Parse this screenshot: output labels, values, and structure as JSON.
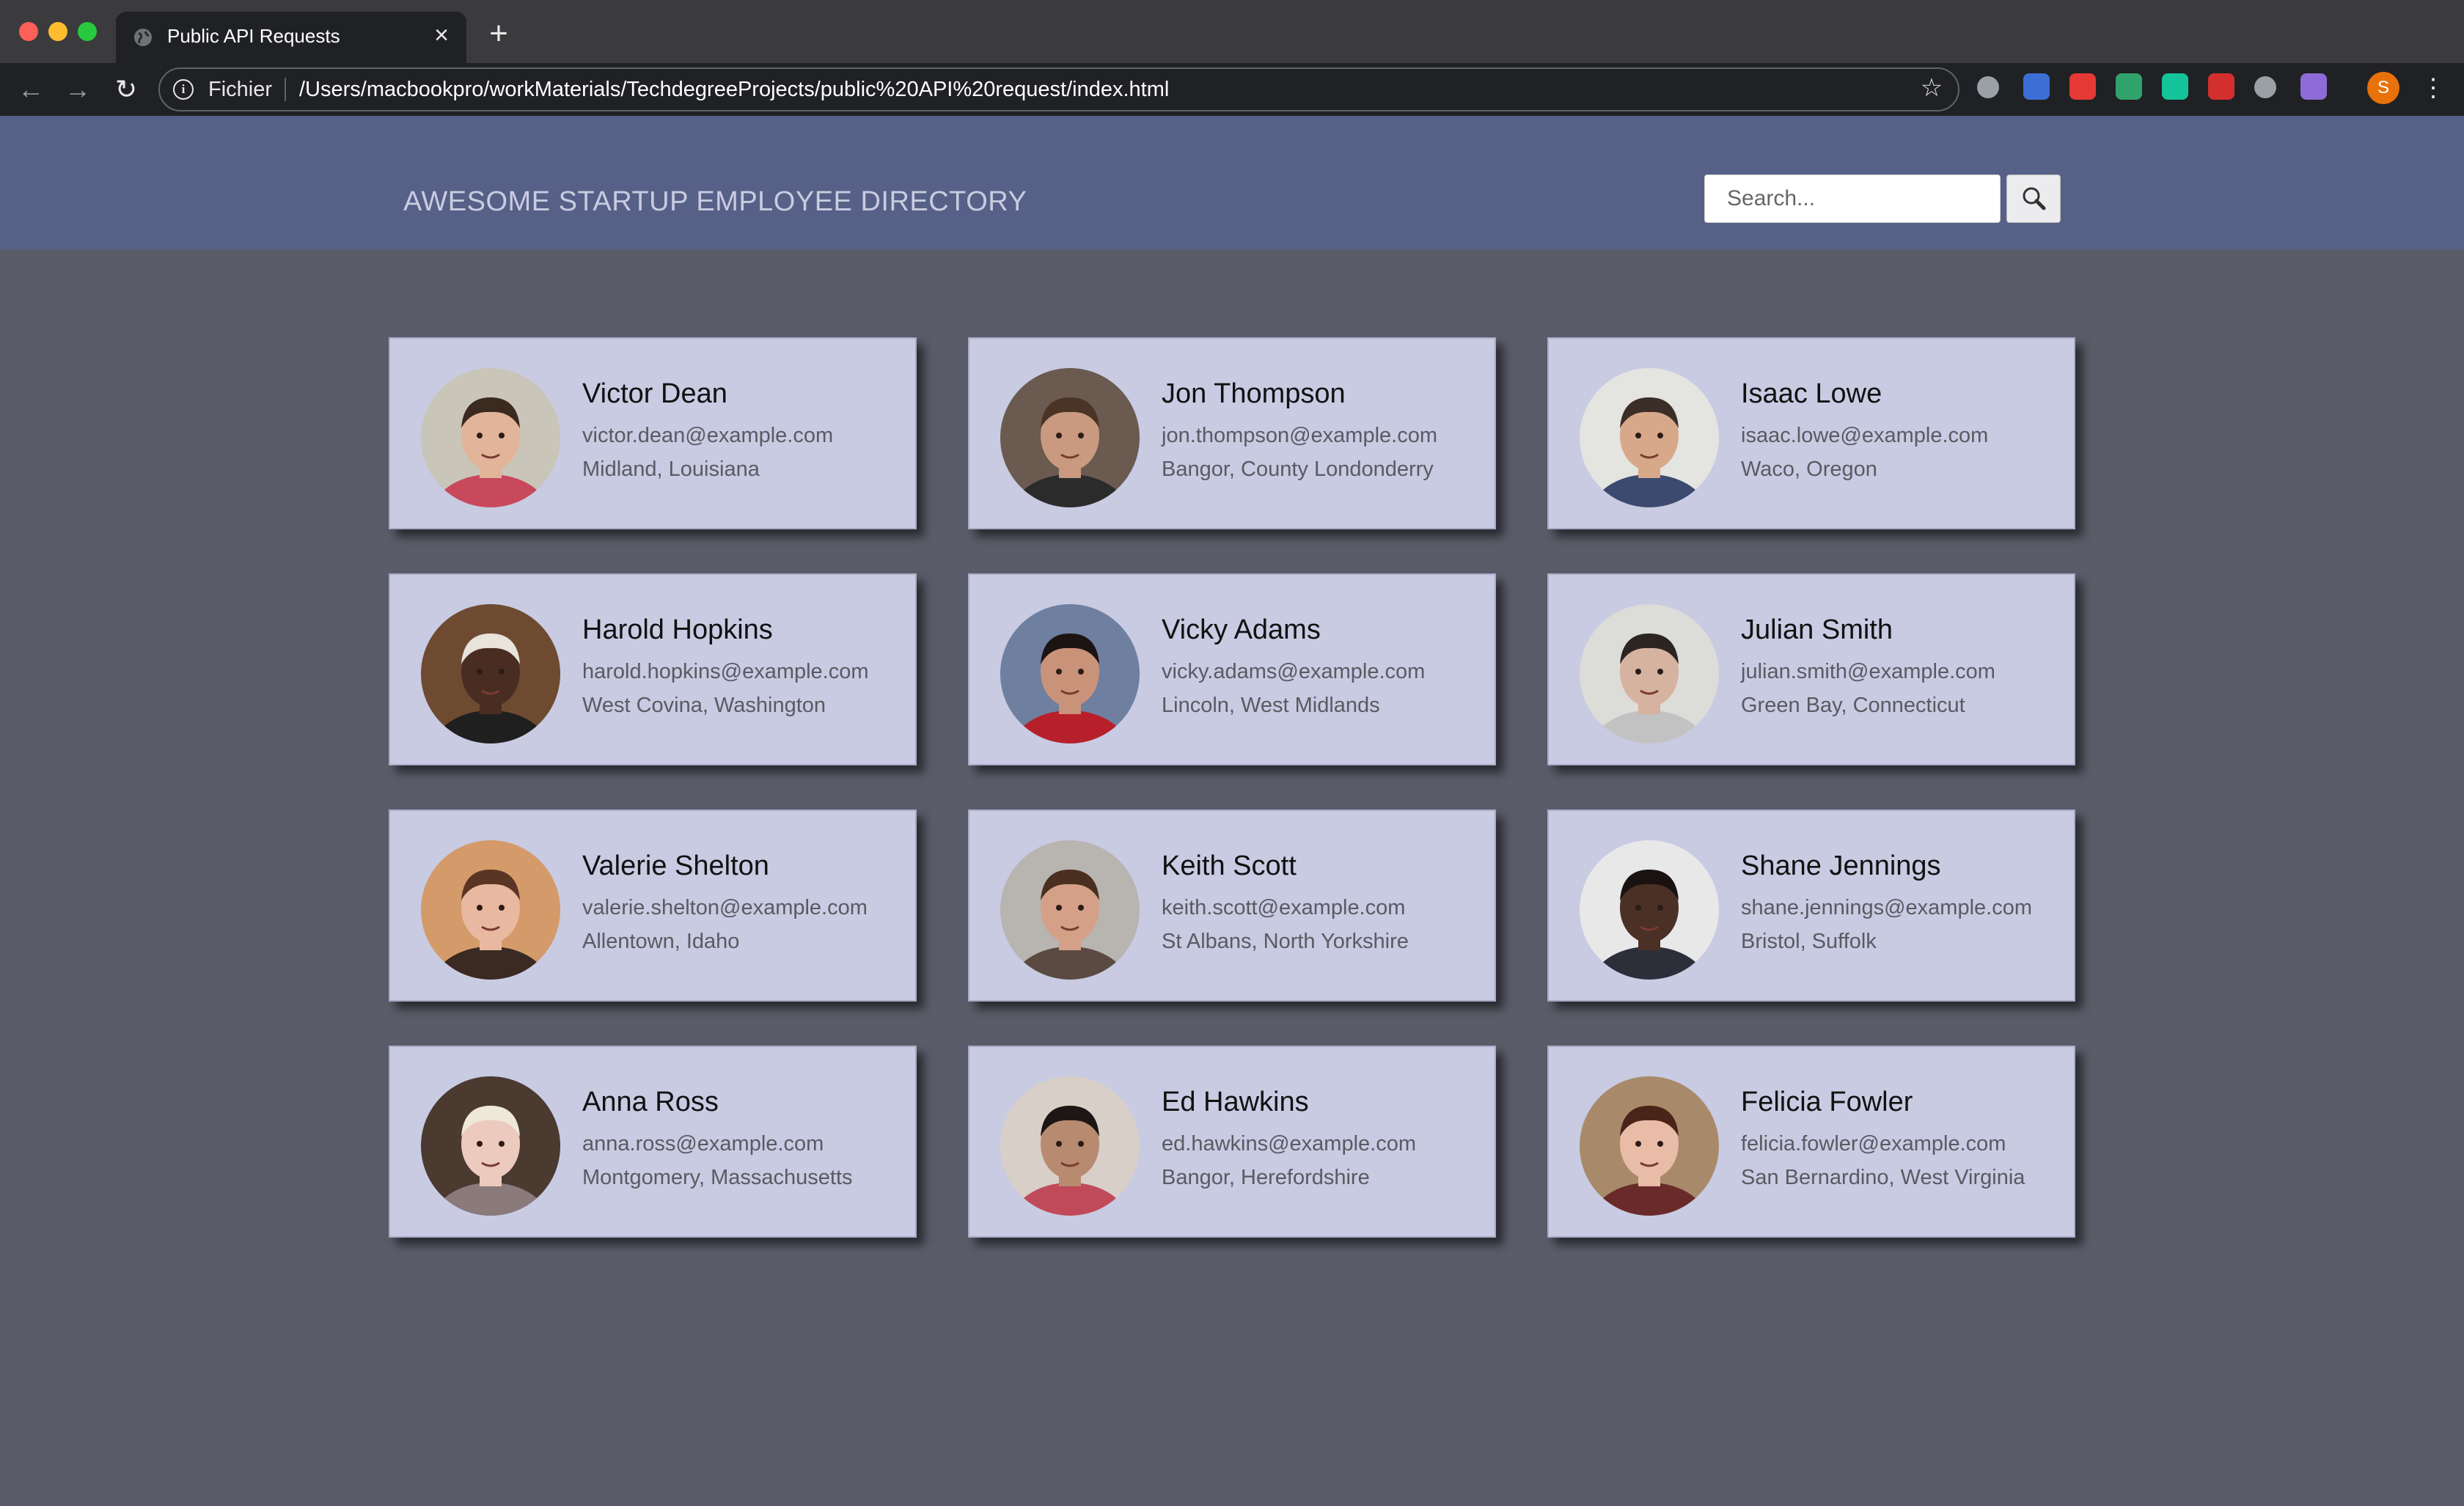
{
  "browser": {
    "tab_title": "Public API Requests",
    "scheme_label": "Fichier",
    "url": "/Users/macbookpro/workMaterials/TechdegreeProjects/public%20API%20request/index.html",
    "profile_initial": "S"
  },
  "header": {
    "title": "AWESOME STARTUP EMPLOYEE DIRECTORY",
    "search_placeholder": "Search...",
    "search_value": ""
  },
  "colors": {
    "header_bg": "#576087",
    "page_bg": "#5b5c69",
    "card_bg": "#c8cbe2"
  },
  "employees": [
    {
      "name": "Victor Dean",
      "email": "victor.dean@example.com",
      "location": "Midland, Louisiana",
      "skin": "#e2b59a",
      "hair": "#3a2a20",
      "shirt": "#c8485c",
      "bg": "#c9c5b8"
    },
    {
      "name": "Jon Thompson",
      "email": "jon.thompson@example.com",
      "location": "Bangor, County Londonderry",
      "skin": "#c99a80",
      "hair": "#4a3426",
      "shirt": "#2b2b2b",
      "bg": "#6b5a50"
    },
    {
      "name": "Isaac Lowe",
      "email": "isaac.lowe@example.com",
      "location": "Waco, Oregon",
      "skin": "#d8a88a",
      "hair": "#3b2e28",
      "shirt": "#3b4a6e",
      "bg": "#e4e4e0"
    },
    {
      "name": "Harold Hopkins",
      "email": "harold.hopkins@example.com",
      "location": "West Covina, Washington",
      "skin": "#4a2d22",
      "hair": "#e8e4dc",
      "shirt": "#1f1f1f",
      "bg": "#6e4b30"
    },
    {
      "name": "Vicky Adams",
      "email": "vicky.adams@example.com",
      "location": "Lincoln, West Midlands",
      "skin": "#c9937a",
      "hair": "#1c1412",
      "shirt": "#b7202a",
      "bg": "#6e7fa0"
    },
    {
      "name": "Julian Smith",
      "email": "julian.smith@example.com",
      "location": "Green Bay, Connecticut",
      "skin": "#d6b2a0",
      "hair": "#2b2420",
      "shirt": "#c2c2c2",
      "bg": "#dcdcd8"
    },
    {
      "name": "Valerie Shelton",
      "email": "valerie.shelton@example.com",
      "location": "Allentown, Idaho",
      "skin": "#e8b8a0",
      "hair": "#5a3424",
      "shirt": "#3a2a22",
      "bg": "#d49a6a"
    },
    {
      "name": "Keith Scott",
      "email": "keith.scott@example.com",
      "location": "St Albans, North Yorkshire",
      "skin": "#d4a088",
      "hair": "#4a2e20",
      "shirt": "#5a4a42",
      "bg": "#b8b4b0"
    },
    {
      "name": "Shane Jennings",
      "email": "shane.jennings@example.com",
      "location": "Bristol, Suffolk",
      "skin": "#4b3025",
      "hair": "#1a1210",
      "shirt": "#2c2f3a",
      "bg": "#e8e8e8"
    },
    {
      "name": "Anna Ross",
      "email": "anna.ross@example.com",
      "location": "Montgomery, Massachusetts",
      "skin": "#eccabe",
      "hair": "#efe8d8",
      "shirt": "#8a7a7a",
      "bg": "#4a3a30"
    },
    {
      "name": "Ed Hawkins",
      "email": "ed.hawkins@example.com",
      "location": "Bangor, Herefordshire",
      "skin": "#b88a70",
      "hair": "#1c1614",
      "shirt": "#c04a5a",
      "bg": "#d8cfc8"
    },
    {
      "name": "Felicia Fowler",
      "email": "felicia.fowler@example.com",
      "location": "San Bernardino, West Virginia",
      "skin": "#e8bca6",
      "hair": "#4a2418",
      "shirt": "#6a2a2a",
      "bg": "#a88a6a"
    }
  ],
  "extensions": [
    {
      "icon": "formula-extension-icon",
      "color": "#9aa0a6"
    },
    {
      "icon": "translate-extension-icon",
      "color": "#3b6fd6"
    },
    {
      "icon": "adblock-extension-icon",
      "color": "#e53935"
    },
    {
      "icon": "image-extension-icon",
      "color": "#2fa36b"
    },
    {
      "icon": "grammarly-extension-icon",
      "color": "#15c39a"
    },
    {
      "icon": "red-extension-icon",
      "color": "#d32f2f"
    },
    {
      "icon": "pinterest-extension-icon",
      "color": "#9aa0a6"
    },
    {
      "icon": "feather-extension-icon",
      "color": "#8e6bd8"
    }
  ]
}
